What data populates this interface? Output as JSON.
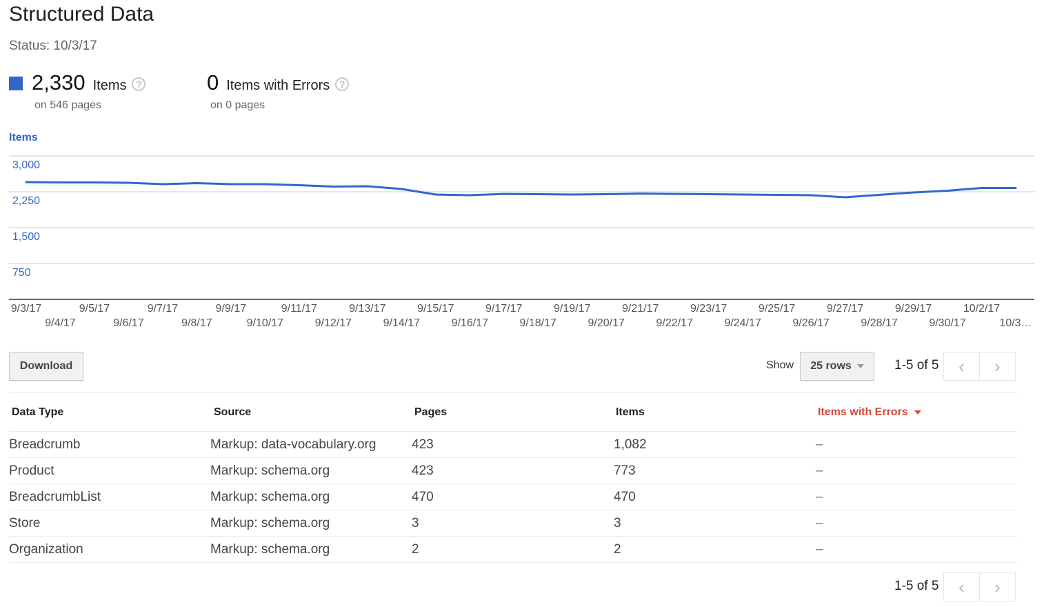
{
  "page": {
    "title": "Structured Data",
    "status": "Status: 10/3/17"
  },
  "summary": {
    "items": {
      "count": "2,330",
      "label": "Items",
      "sub": "on 546 pages",
      "swatch_color": "#3366cc",
      "help_icon": "question-circle-icon"
    },
    "errors": {
      "count": "0",
      "label": "Items with Errors",
      "sub": "on 0 pages",
      "help_icon": "question-circle-icon"
    }
  },
  "chart_data": {
    "type": "line",
    "title": "",
    "legend": "Items",
    "legend_placement": "top-left",
    "xlabel": "",
    "ylabel": "",
    "ylim": [
      0,
      3000
    ],
    "yticks": [
      750,
      1500,
      2250,
      3000
    ],
    "ytick_labels": [
      "750",
      "1,500",
      "2,250",
      "3,000"
    ],
    "grid": true,
    "line_color": "#3366cc",
    "x": [
      "9/3/17",
      "9/4/17",
      "9/5/17",
      "9/6/17",
      "9/7/17",
      "9/8/17",
      "9/9/17",
      "9/10/17",
      "9/11/17",
      "9/12/17",
      "9/13/17",
      "9/14/17",
      "9/15/17",
      "9/16/17",
      "9/17/17",
      "9/18/17",
      "9/19/17",
      "9/20/17",
      "9/21/17",
      "9/22/17",
      "9/23/17",
      "9/24/17",
      "9/25/17",
      "9/26/17",
      "9/27/17",
      "9/28/17",
      "9/29/17",
      "9/30/17",
      "10/2/17",
      "10/3…"
    ],
    "series": [
      {
        "name": "Items",
        "values": [
          2452,
          2445,
          2445,
          2437,
          2408,
          2430,
          2408,
          2408,
          2387,
          2358,
          2365,
          2307,
          2192,
          2178,
          2206,
          2199,
          2192,
          2199,
          2213,
          2206,
          2199,
          2192,
          2185,
          2178,
          2134,
          2185,
          2235,
          2271,
          2329,
          2330
        ]
      }
    ]
  },
  "toolbar": {
    "download_label": "Download",
    "show_label": "Show",
    "rows_selected": "25 rows",
    "pager_text": "1-5 of 5",
    "prev_icon": "‹",
    "next_icon": "›"
  },
  "table": {
    "columns": [
      "Data Type",
      "Source",
      "Pages",
      "Items",
      "Items with Errors"
    ],
    "sorted_column": "Items with Errors",
    "sort_color": "#d14836",
    "rows": [
      [
        "Breadcrumb",
        "Markup: data-vocabulary.org",
        "423",
        "1,082",
        "–"
      ],
      [
        "Product",
        "Markup: schema.org",
        "423",
        "773",
        "–"
      ],
      [
        "BreadcrumbList",
        "Markup: schema.org",
        "470",
        "470",
        "–"
      ],
      [
        "Store",
        "Markup: schema.org",
        "3",
        "3",
        "–"
      ],
      [
        "Organization",
        "Markup: schema.org",
        "2",
        "2",
        "–"
      ]
    ]
  },
  "footer": {
    "pager_text": "1-5 of 5"
  }
}
